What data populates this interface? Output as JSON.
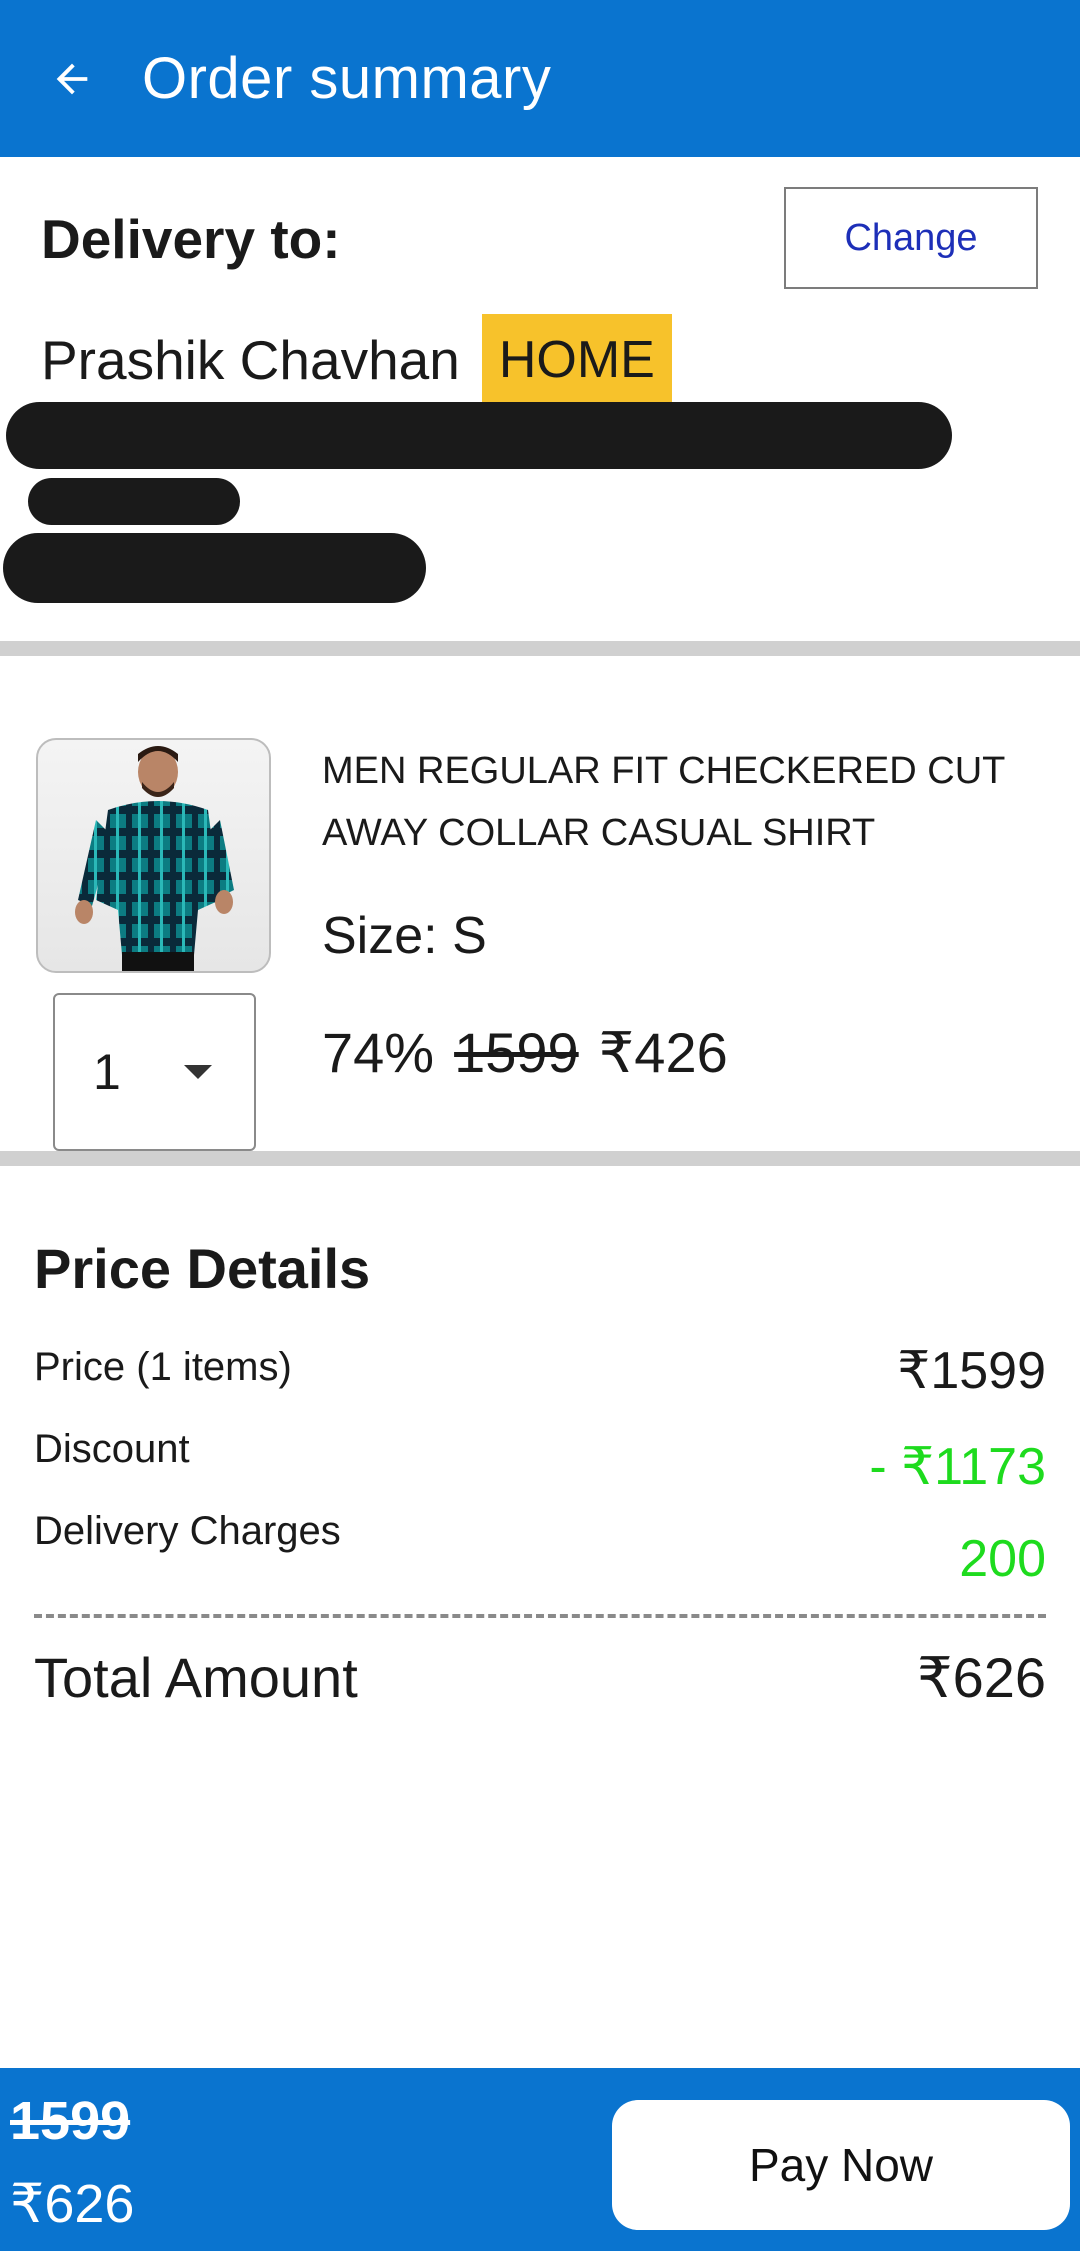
{
  "header": {
    "title": "Order summary",
    "back_icon": "arrow-left-icon"
  },
  "delivery": {
    "label": "Delivery to:",
    "change_label": "Change",
    "recipient_name": "Prashik Chavhan",
    "address_tag": "HOME",
    "tag_color": "#f7c22b"
  },
  "product": {
    "title": "MEN REGULAR FIT CHECKERED CUT AWAY COLLAR CASUAL SHIRT",
    "size_label": "Size:",
    "size_value": "S",
    "quantity": "1",
    "discount_percent": "74%",
    "original_price": "1599",
    "final_price": "₹426"
  },
  "price_details": {
    "title": "Price Details",
    "rows": [
      {
        "label": "Price (1 items)",
        "value": "₹1599"
      },
      {
        "label": "Discount",
        "value": "- ₹1173"
      },
      {
        "label": "Delivery Charges",
        "value": "200"
      }
    ],
    "total_label": "Total Amount",
    "total_value": "₹626"
  },
  "bottom_bar": {
    "original_total": "1599",
    "final_total": "₹626",
    "pay_label": "Pay Now"
  },
  "colors": {
    "primary": "#0a74cf",
    "discount_green": "#1edb1e",
    "change_text": "#1d2fb8"
  }
}
